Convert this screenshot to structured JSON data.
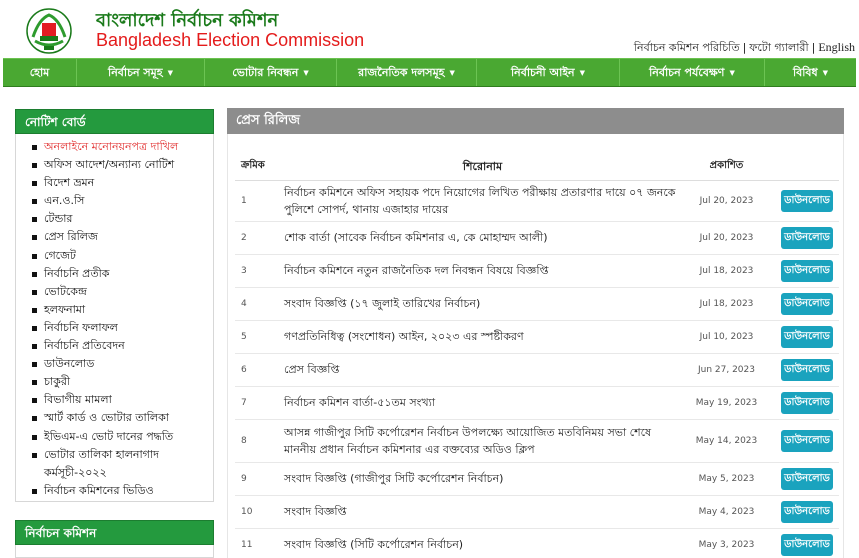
{
  "header": {
    "title_bn": "বাংলাদেশ নির্বাচন কমিশন",
    "title_en": "Bangladesh Election Commission",
    "links": [
      "নির্বাচন কমিশন পরিচিতি",
      "ফটো গ্যালারী",
      "English"
    ],
    "brand_green": "#4aa832"
  },
  "nav": {
    "items": [
      {
        "label": "হোম",
        "dropdown": false
      },
      {
        "label": "নির্বাচন সমূহ",
        "dropdown": true
      },
      {
        "label": "ভোটার নিবন্ধন",
        "dropdown": true
      },
      {
        "label": "রাজনৈতিক দলসমূহ",
        "dropdown": true
      },
      {
        "label": "নির্বাচনী আইন",
        "dropdown": true
      },
      {
        "label": "নির্বাচন পর্যবেক্ষণ",
        "dropdown": true
      },
      {
        "label": "বিবিধ",
        "dropdown": true
      }
    ]
  },
  "sidebar": {
    "notice_title": "নোটিশ বোর্ড",
    "notice_items": [
      "অনলাইনে মনোনয়নপত্র দাখিল",
      "অফিস আদেশ/অন্যান্য নোটিশ",
      "বিদেশ ভ্রমন",
      "এন.ও.সি",
      "টেন্ডার",
      "প্রেস রিলিজ",
      "গেজেট",
      "নির্বাচনি প্রতীক",
      "ভোটকেন্দ্র",
      "হলফনামা",
      "নির্বাচনি ফলাফল",
      "নির্বাচনি প্রতিবেদন",
      "ডাউনলোড",
      "চাকুরী",
      "বিভাগীয় মামলা",
      "স্মার্ট কার্ড ও ভোটার তালিকা",
      "ইভিএম-এ ভোট দানের পদ্ধতি",
      "ভোটার তালিকা হালনাগাদ কর্মসূচী-২০২২",
      "নির্বাচন কমিশনের ভিডিও"
    ],
    "ec_title": "নির্বাচন কমিশন"
  },
  "main": {
    "panel_title": "প্রেস রিলিজ",
    "columns": [
      "ক্রমিক",
      "শিরোনাম",
      "প্রকাশিত"
    ],
    "download_label": "ডাউনলোড",
    "rows": [
      {
        "sl": "1",
        "title": "নির্বাচন কমিশনে অফিস সহায়ক পদে নিয়োগের লিখিত পরীক্ষায় প্রতারণার দায়ে ০৭ জনকে পুলিশে সোপর্দ, থানায় এজাহার দায়ের",
        "date": "Jul 20, 2023"
      },
      {
        "sl": "2",
        "title": "শোক বার্তা (সাবেক নির্বাচন কমিশনার এ, কে মোহাম্মদ আলী)",
        "date": "Jul 20, 2023"
      },
      {
        "sl": "3",
        "title": "নির্বাচন কমিশনে নতুন রাজনৈতিক দল নিবন্ধন বিষয়ে বিজ্ঞপ্তি",
        "date": "Jul 18, 2023"
      },
      {
        "sl": "4",
        "title": "সংবাদ বিজ্ঞপ্তি (১৭ জুলাই তারিখের নির্বাচন)",
        "date": "Jul 18, 2023"
      },
      {
        "sl": "5",
        "title": "গণপ্রতিনিধিত্ব (সংশোধন) আইন, ২০২৩ এর স্পষ্টীকরণ",
        "date": "Jul 10, 2023"
      },
      {
        "sl": "6",
        "title": "প্রেস বিজ্ঞপ্তি",
        "date": "Jun 27, 2023"
      },
      {
        "sl": "7",
        "title": "নির্বাচন কমিশন বার্তা-৫১তম সংখ্যা",
        "date": "May 19, 2023"
      },
      {
        "sl": "8",
        "title": "আসন্ন গাজীপুর সিটি কর্পোরেশন নির্বাচন উপলক্ষ্যে আয়োজিত মতবিনিময় সভা শেষে মাননীয় প্রধান নির্বাচন কমিশনার এর বক্তব্যের অডিও ক্লিপ",
        "date": "May 14, 2023"
      },
      {
        "sl": "9",
        "title": "সংবাদ বিজ্ঞপ্তি (গাজীপুর সিটি কর্পোরেশন নির্বাচন)",
        "date": "May 5, 2023"
      },
      {
        "sl": "10",
        "title": "সংবাদ বিজ্ঞপ্তি",
        "date": "May 4, 2023"
      },
      {
        "sl": "11",
        "title": "সংবাদ বিজ্ঞপ্তি (সিটি কর্পোরেশন নির্বাচন)",
        "date": "May 3, 2023"
      }
    ]
  }
}
